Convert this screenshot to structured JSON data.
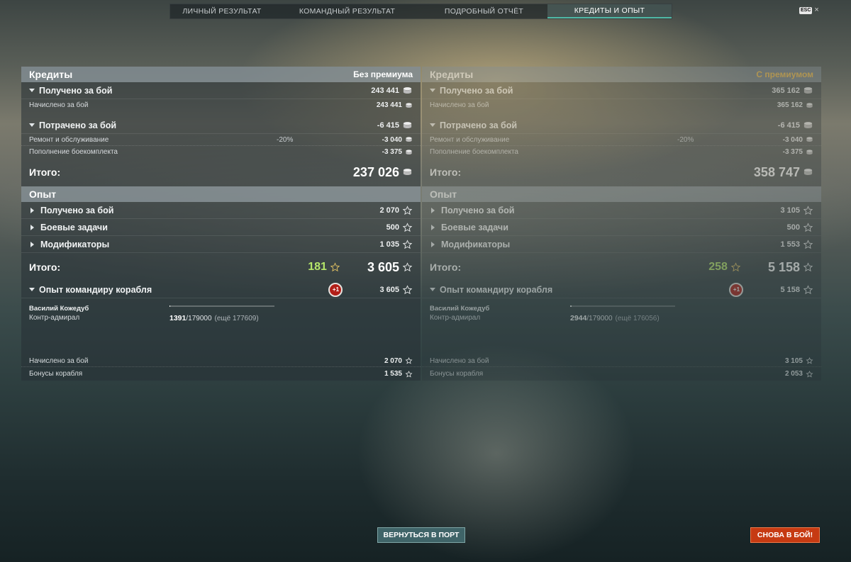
{
  "tabs": [
    {
      "label": "ЛИЧНЫЙ РЕЗУЛЬТАТ"
    },
    {
      "label": "КОМАНДНЫЙ РЕЗУЛЬТАТ"
    },
    {
      "label": "ПОДРОБНЫЙ ОТЧЁТ"
    },
    {
      "label": "КРЕДИТЫ И ОПЫТ",
      "active": true
    }
  ],
  "esc": {
    "label": "ESC",
    "close": "×"
  },
  "left": {
    "credits_title": "Кредиты",
    "mode": "Без премиума",
    "earned_label": "Получено за бой",
    "earned": "243 441",
    "accrued_label": "Начислено за бой",
    "accrued": "243 441",
    "spent_label": "Потрачено за бой",
    "spent": "-6 415",
    "repair_label": "Ремонт и обслуживание",
    "repair_pct": "-20%",
    "repair": "-3 040",
    "ammo_label": "Пополнение боекомплекта",
    "ammo": "-3 375",
    "total_label": "Итого:",
    "total": "237 026",
    "xp_title": "Опыт",
    "xp_earned_label": "Получено за бой",
    "xp_earned": "2 070",
    "tasks_label": "Боевые задачи",
    "tasks": "500",
    "mods_label": "Модификаторы",
    "mods": "1 035",
    "xp_total_label": "Итого:",
    "xp_free": "181",
    "xp_total": "3 605",
    "cmd_label": "Опыт командиру корабля",
    "cmd_badge": "+1",
    "cmd_xp": "3 605",
    "commander_name": "Василий Кожедуб",
    "commander_rank": "Контр-адмирал",
    "cmd_progress_cur": "1391",
    "cmd_progress_max": "/179000",
    "cmd_progress_more": "(ещё 177609)",
    "cmd_progress": 0.0078,
    "cmd_accrued_label": "Начислено за бой",
    "cmd_accrued": "2 070",
    "ship_bonus_label": "Бонусы корабля",
    "ship_bonus": "1 535"
  },
  "right": {
    "credits_title": "Кредиты",
    "mode": "С премиумом",
    "earned_label": "Получено за бой",
    "earned": "365 162",
    "accrued_label": "Начислено за бой",
    "accrued": "365 162",
    "spent_label": "Потрачено за бой",
    "spent": "-6 415",
    "repair_label": "Ремонт и обслуживание",
    "repair_pct": "-20%",
    "repair": "-3 040",
    "ammo_label": "Пополнение боекомплекта",
    "ammo": "-3 375",
    "total_label": "Итого:",
    "total": "358 747",
    "xp_title": "Опыт",
    "xp_earned_label": "Получено за бой",
    "xp_earned": "3 105",
    "tasks_label": "Боевые задачи",
    "tasks": "500",
    "mods_label": "Модификаторы",
    "mods": "1 553",
    "xp_total_label": "Итого:",
    "xp_free": "258",
    "xp_total": "5 158",
    "cmd_label": "Опыт командиру корабля",
    "cmd_badge": "+1",
    "cmd_xp": "5 158",
    "commander_name": "Василий Кожедуб",
    "commander_rank": "Контр-адмирал",
    "cmd_progress_cur": "2944",
    "cmd_progress_max": "/179000",
    "cmd_progress_more": "(ещё 176056)",
    "cmd_progress": 0.0164,
    "cmd_accrued_label": "Начислено за бой",
    "cmd_accrued": "3 105",
    "ship_bonus_label": "Бонусы корабля",
    "ship_bonus": "2 053"
  },
  "buttons": {
    "port": "ВЕРНУТЬСЯ В ПОРТ",
    "fight": "СНОВА В БОЙ!"
  },
  "icons": {
    "credits": "credits-coin-icon",
    "xp": "star-outline-icon",
    "free_xp": "star-outline-icon"
  },
  "colors": {
    "premium": "#ffc64a",
    "free_xp": "#b5e66a",
    "active_tab": "#4fb8a6",
    "fight_button": "#c63a12",
    "port_button": "#3f6468",
    "badge": "#b21f18"
  }
}
